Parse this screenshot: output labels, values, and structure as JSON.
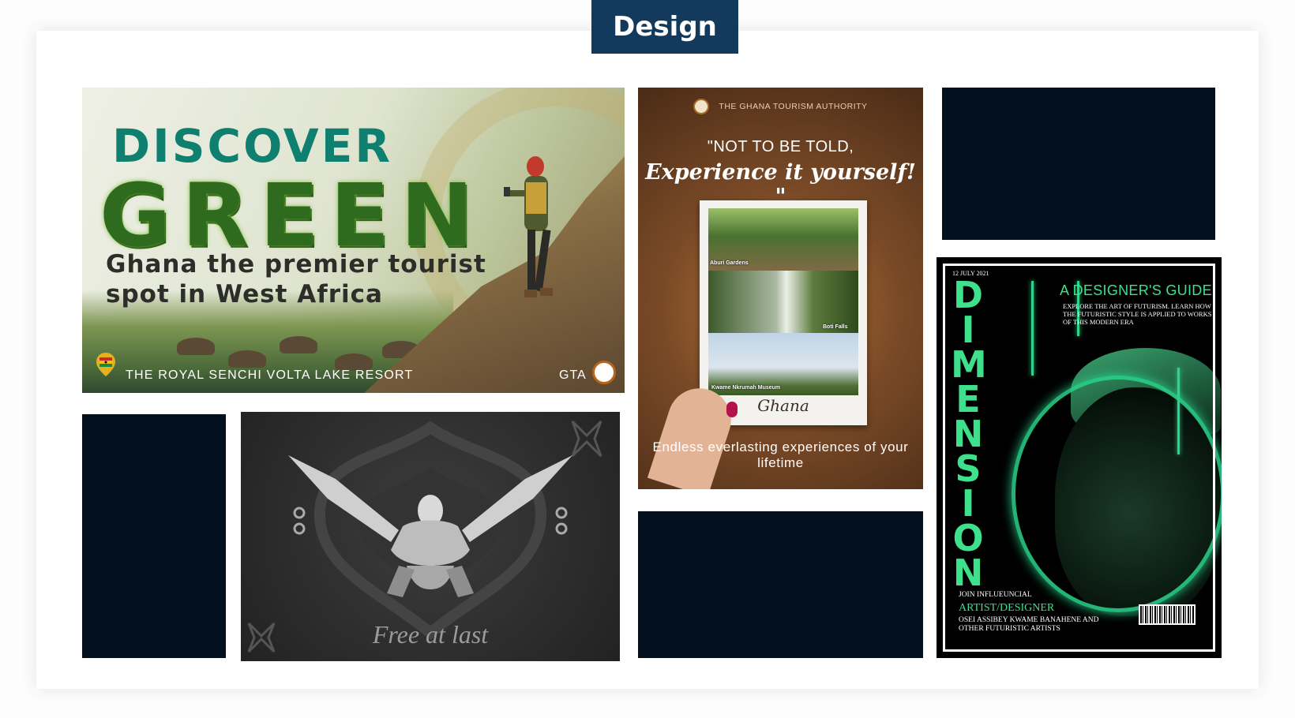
{
  "section_title": "Design",
  "discover_green": {
    "line1": "DISCOVER",
    "line2": "GREEN",
    "subtitle": "Ghana the premier tourist spot in West Africa",
    "location": "THE ROYAL SENCHI VOLTA LAKE RESORT",
    "brand": "GTA"
  },
  "free_at_last": {
    "caption": "Free at last"
  },
  "ghana_tourism": {
    "authority": "THE GHANA TOURISM AUTHORITY",
    "quote_line1": "\"NOT TO BE TOLD,",
    "quote_line2": "Experience it yourself! \"",
    "photos": [
      {
        "caption": "Aburi Gardens"
      },
      {
        "caption": "Boti Falls"
      },
      {
        "caption": "Kwame Nkrumah Museum"
      }
    ],
    "card_word": "Ghana",
    "footer": "Endless everlasting experiences of your lifetime"
  },
  "dimension": {
    "date": "12 JULY 2021",
    "title": "DIMENSION",
    "guide_title": "A DESIGNER'S GUIDE",
    "guide_text": "EXPLORE THE ART OF FUTURISM. LEARN HOW THE FUTURISTIC STYLE IS APPLIED TO WORKS OF THIS MODERN ERA",
    "join": "JOIN INFLUEUNCIAL",
    "artist": "ARTIST/DESIGNER",
    "names": "OSEI ASSIBEY KWAME BANAHENE AND OTHER FUTURISTIC ARTISTS"
  },
  "colors": {
    "navy": "#03111f",
    "tab": "#133a5c",
    "neon_green": "#3ee08c"
  }
}
